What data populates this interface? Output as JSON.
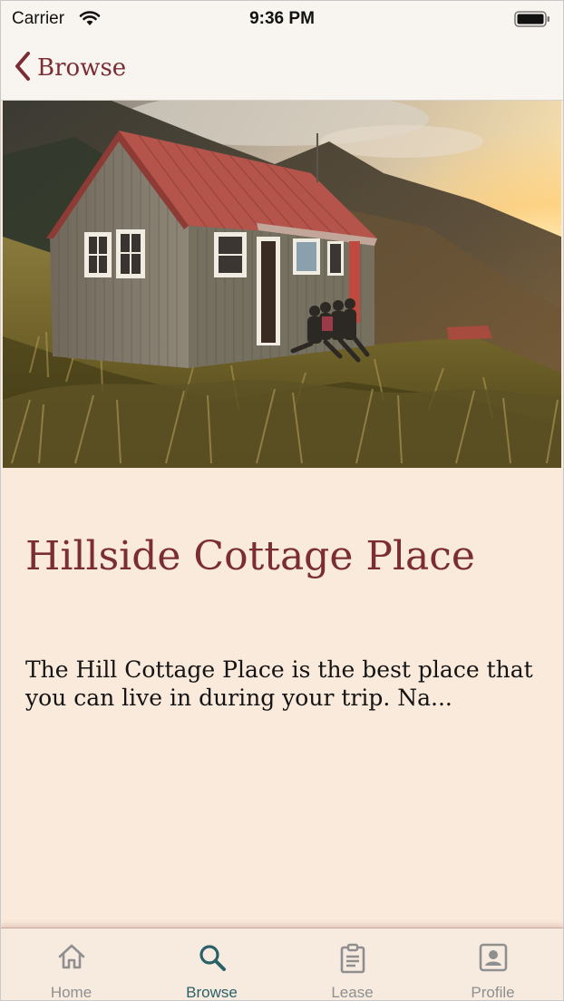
{
  "status_bar": {
    "carrier": "Carrier",
    "time": "9:36 PM"
  },
  "nav": {
    "back_label": "Browse",
    "back_icon": "chevron-left-icon"
  },
  "hero": {
    "image": "hillside-cottage-photo"
  },
  "listing": {
    "title": "Hillside Cottage Place",
    "description": "The Hill Cottage Place is the best place that you can live in during your trip. Na..."
  },
  "tab_bar": {
    "active": "Browse",
    "tabs": [
      {
        "label": "Home",
        "icon": "home-icon"
      },
      {
        "label": "Browse",
        "icon": "search-icon"
      },
      {
        "label": "Lease",
        "icon": "clipboard-icon"
      },
      {
        "label": "Profile",
        "icon": "profile-card-icon"
      }
    ]
  },
  "colors": {
    "accent": "#7b2d34",
    "active_tab": "#2a6168",
    "inactive_tab": "#8f8f8f",
    "background": "#faeadb"
  }
}
